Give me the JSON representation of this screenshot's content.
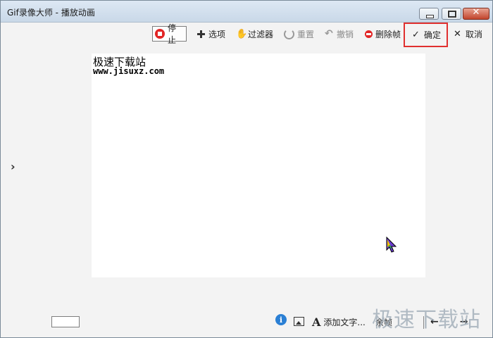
{
  "window": {
    "title": "Gif录像大师 - 播放动画"
  },
  "toolbar": {
    "stop": "停止",
    "options": "选项",
    "filter": "过滤器",
    "reset": "重置",
    "undo": "撤销",
    "delete_frame": "删除帧",
    "ok": "确定",
    "cancel": "取消"
  },
  "canvas": {
    "line1": "极速下载站",
    "line2": "www.jisuxz.com"
  },
  "bottom": {
    "info_icon_glyph": "i",
    "add_text": "添加文字...",
    "more": "余帧"
  },
  "watermark": "极速下载站",
  "icons": {
    "stop": "stop-icon",
    "options": "plus-icon",
    "filter": "hand-icon",
    "reset": "reset-icon",
    "undo": "undo-icon",
    "delete": "delete-icon",
    "ok": "check-icon",
    "cancel": "close-icon",
    "expand": "chevron-right-icon",
    "info": "info-icon",
    "image": "image-icon",
    "add_text": "text-icon"
  },
  "colors": {
    "highlight_border": "#e0302f",
    "stop_red": "#e22525",
    "info_blue": "#2a7fd4"
  }
}
